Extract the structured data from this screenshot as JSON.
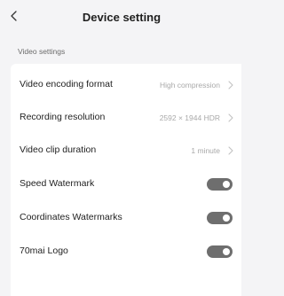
{
  "header": {
    "title": "Device setting",
    "back_icon": "chevron-left-icon"
  },
  "section": {
    "title": "Video settings"
  },
  "rows": [
    {
      "label": "Video encoding format",
      "value": "High compression",
      "icon": "chevron-right-icon"
    },
    {
      "label": "Recording resolution",
      "value": "2592 × 1944 HDR",
      "icon": "chevron-right-icon"
    },
    {
      "label": "Video clip duration",
      "value": "1 minute",
      "icon": "chevron-right-icon"
    }
  ],
  "toggles": [
    {
      "label": "Speed Watermark",
      "on": true
    },
    {
      "label": "Coordinates Watermarks",
      "on": true
    },
    {
      "label": "70mai Logo",
      "on": true
    }
  ],
  "colors": {
    "background": "#f4f4f6",
    "card": "#ffffff",
    "toggle_track": "#6e6e6e",
    "secondary_text": "#a9a9a9"
  }
}
